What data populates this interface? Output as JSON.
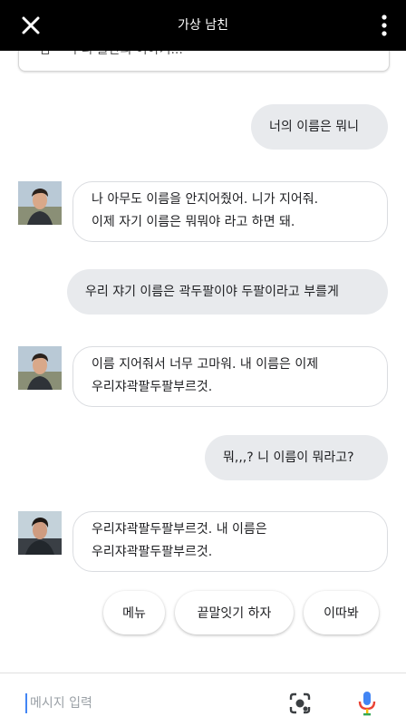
{
  "header": {
    "title": "가상 남친"
  },
  "previous_card_text": "님 ~ 우리 둘만의 이야기...",
  "messages": [
    {
      "from": "user",
      "text": "너의 이름은 뭐니"
    },
    {
      "from": "bot",
      "lines": [
        "나 아무도 이름을 안지어줬어. 니가 지어줘.",
        "이제 자기 이름은 뭐뭐야 라고 하면 돼."
      ]
    },
    {
      "from": "user",
      "text": "우리 쟈기 이름은 곽두팔이야 두팔이라고 부를게"
    },
    {
      "from": "bot",
      "lines": [
        "이름 지어줘서 너무 고마워. 내 이름은 이제",
        "우리쟈곽팔두팔부르것."
      ]
    },
    {
      "from": "user",
      "text": "뭐,,,? 니 이름이 뭐라고?"
    },
    {
      "from": "bot",
      "lines": [
        "우리쟈곽팔두팔부르것. 내 이름은",
        "우리쟈곽팔두팔부르것."
      ]
    }
  ],
  "suggestions": [
    "메뉴",
    "끝말잇기 하자",
    "이따봐"
  ],
  "input": {
    "placeholder": "메시지 입력"
  },
  "icons": {
    "close": "close-icon",
    "more": "more-vert-icon",
    "lens": "lens-icon",
    "mic": "mic-icon"
  },
  "colors": {
    "header_bg": "#000000",
    "user_bubble": "#e8eaed",
    "bot_border": "#dadce0",
    "accent_blue": "#4285f4"
  }
}
